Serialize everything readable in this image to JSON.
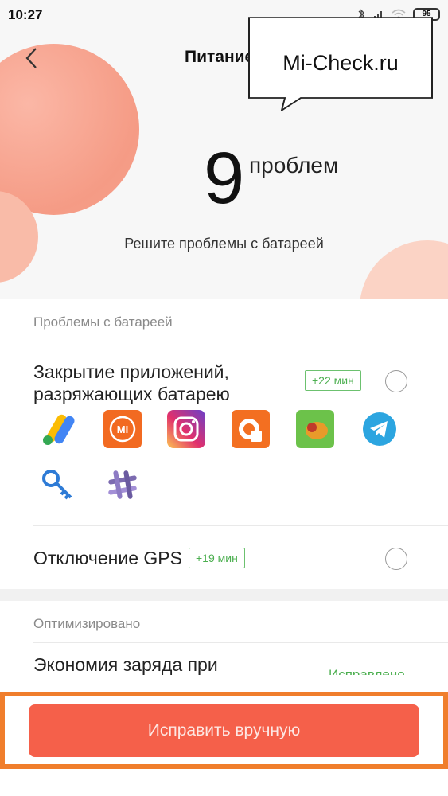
{
  "status_bar": {
    "time": "10:27",
    "battery": "95"
  },
  "header": {
    "title": "Питание"
  },
  "watermark": {
    "text": "Mi-Check.ru"
  },
  "summary": {
    "count": "9",
    "count_word": "проблем",
    "subtitle": "Решите проблемы с батареей"
  },
  "battery_section": {
    "label": "Проблемы с батареей",
    "items": [
      {
        "title_line1": "Закрытие приложений,",
        "title_line2": "разряжающих батарею",
        "badge": "+22 мин",
        "apps": [
          "google-ads-icon",
          "mi-remote-icon",
          "instagram-icon",
          "podcast-app-icon",
          "green-game-icon",
          "telegram-icon",
          "key-app-icon",
          "slack-icon"
        ]
      },
      {
        "title": "Отключение GPS",
        "badge": "+19 мин"
      }
    ]
  },
  "optimized_section": {
    "label": "Оптимизировано",
    "items": [
      {
        "title": "Экономия заряда при",
        "status": "Исправлено"
      }
    ]
  },
  "footer": {
    "fix_button": "Исправить вручную"
  },
  "colors": {
    "accent": "#f5604a",
    "green": "#4caf50",
    "frame": "#f07e2c"
  }
}
